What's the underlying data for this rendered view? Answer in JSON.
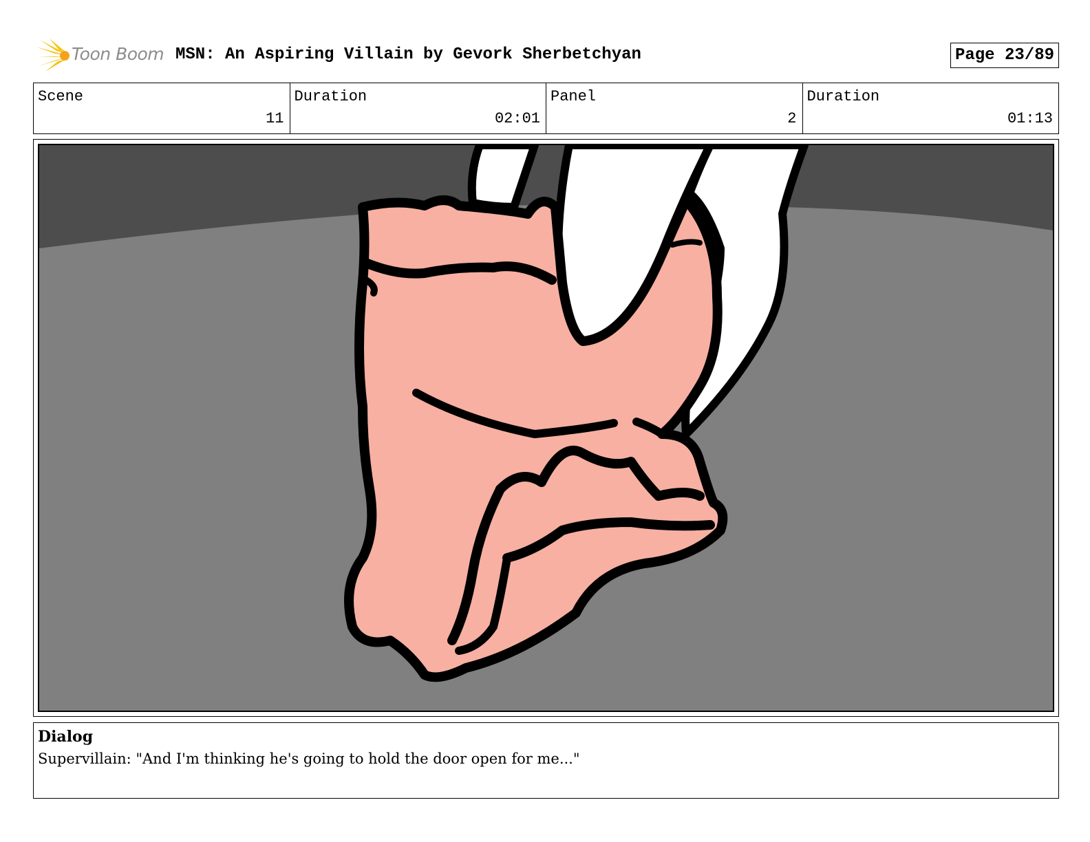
{
  "header": {
    "logo_text": "Toon Boom",
    "title": "MSN: An Aspiring Villain by Gevork Sherbetchyan",
    "page": "Page 23/89"
  },
  "info": {
    "scene_label": "Scene",
    "scene_value": "11",
    "scene_duration_label": "Duration",
    "scene_duration_value": "02:01",
    "panel_label": "Panel",
    "panel_value": "2",
    "panel_duration_label": "Duration",
    "panel_duration_value": "01:13"
  },
  "dialog": {
    "label": "Dialog",
    "text": "Supervillain: \"And I'm thinking he's going to hold the door open for me...\""
  },
  "colors": {
    "background_dark": "#4d4d4d",
    "background_floor": "#808080",
    "skin": "#f7b0a2",
    "outline": "#000000",
    "logo_yellow": "#f5c518"
  }
}
